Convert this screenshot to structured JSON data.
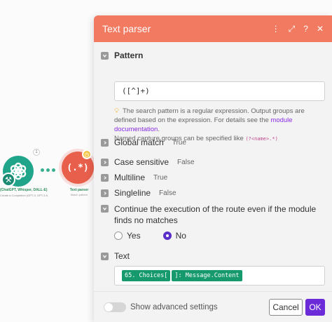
{
  "canvas": {
    "openai_module": {
      "icon": "openai-icon",
      "label": "(ChatGPT, Whisper, DALL-E)",
      "sublabel": "Create a Completion (GPT-3, GPT-3.5, GPT-4)",
      "handle": "1"
    },
    "parser_module": {
      "icon": "text-parser-icon",
      "glyph": "(.*)",
      "label": "Text parser",
      "sublabel": "Match pattern"
    }
  },
  "dialog": {
    "title": "Text parser",
    "header_icons": [
      "more-vertical-icon",
      "expand-icon",
      "help-icon",
      "close-icon"
    ],
    "header_colour": "#f27a60",
    "pattern": {
      "label": "Pattern",
      "value": "([^]+)",
      "hint_line1": "The search pattern is a regular expression. Output groups are defined based on the expression. For details see the ",
      "hint_link": "module documentation",
      "hint_period": ".",
      "hint_line2": "Named capture groups can be specified like ",
      "hint_code": "(?<name>.*)"
    },
    "global_match": {
      "label": "Global match",
      "value": "True"
    },
    "case_sensitive": {
      "label": "Case sensitive",
      "value": "False"
    },
    "multiline": {
      "label": "Multiline",
      "value": "True"
    },
    "singleline": {
      "label": "Singleline",
      "value": "False"
    },
    "continue_route": {
      "label": "Continue the execution of the route even if the module finds no matches",
      "options": [
        "Yes",
        "No"
      ],
      "selected": "No"
    },
    "text": {
      "label": "Text",
      "pill_1": "65. Choices[",
      "pill_2": "]: Message.Content"
    },
    "footer": {
      "advanced_label": "Show advanced settings",
      "advanced_on": false,
      "cancel_label": "Cancel",
      "ok_label": "OK"
    },
    "accent_colour": "#6c2bd9",
    "pill_colour": "#169a6d"
  }
}
